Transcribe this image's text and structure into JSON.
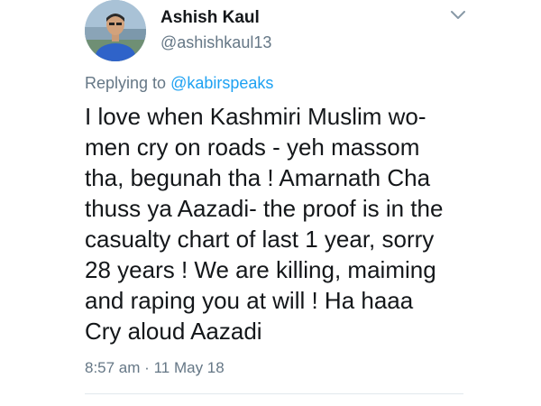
{
  "author": {
    "name": "Ashish Kaul",
    "handle": "@ashishkaul13"
  },
  "reply": {
    "prefix": "Replying to",
    "to": "@kabirspeaks"
  },
  "tweet": {
    "lines": [
      "I love when Kashmiri Muslim wo-",
      "men cry on roads - yeh massom",
      "tha, begunah tha !  Amarnath Cha",
      "thuss ya Aazadi- the proof is in the",
      "casualty chart of last 1 year, sorry",
      "28 years ! We are killing, maiming",
      "and raping you at will ! Ha haaa",
      "Cry aloud Aazadi"
    ]
  },
  "meta": {
    "time": "8:57 am",
    "separator": "·",
    "date": "11 May 18"
  },
  "icons": {
    "menu": "chevron-down-icon",
    "avatar": "avatar"
  },
  "colors": {
    "link": "#1da1f2",
    "secondary_text": "#657786",
    "primary_text": "#14171a"
  }
}
